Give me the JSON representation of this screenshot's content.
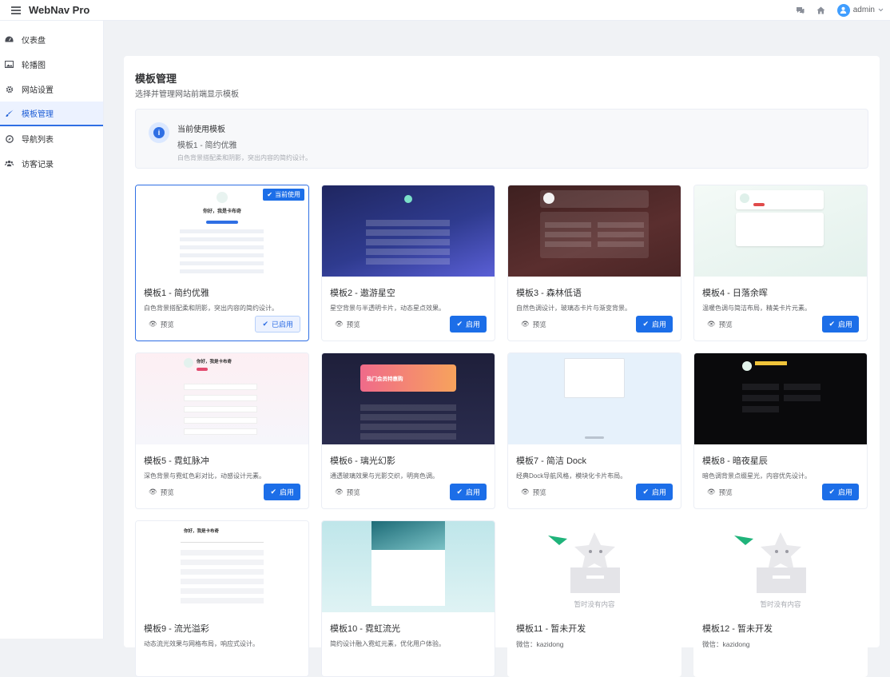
{
  "app": {
    "title": "WebNav Pro",
    "user": "admin"
  },
  "sidebar": {
    "items": [
      {
        "label": "仪表盘",
        "icon": "dashboard-icon"
      },
      {
        "label": "轮播图",
        "icon": "image-icon"
      },
      {
        "label": "网站设置",
        "icon": "gear-icon"
      },
      {
        "label": "模板管理",
        "icon": "brush-icon",
        "active": true
      },
      {
        "label": "导航列表",
        "icon": "compass-icon"
      },
      {
        "label": "访客记录",
        "icon": "users-icon"
      }
    ]
  },
  "page": {
    "title": "模板管理",
    "subtitle": "选择并管理网站前端显示模板"
  },
  "current": {
    "heading": "当前使用模板",
    "name": "模板1 - 简约优雅",
    "desc": "白色背景搭配柔和阴影，突出内容的简约设计。"
  },
  "labels": {
    "preview": "预览",
    "enable": "启用",
    "enabled": "已启用",
    "in_use": "当前使用"
  },
  "templates": [
    {
      "name": "模板1 - 简约优雅",
      "desc": "白色背景搭配柔和阴影，突出内容的简约设计。",
      "status": "active"
    },
    {
      "name": "模板2 - 遨游星空",
      "desc": "星空背景与半透明卡片，动态星点效果。",
      "status": "available"
    },
    {
      "name": "模板3 - 森林低语",
      "desc": "自然色调设计，玻璃态卡片与渐变背景。",
      "status": "available"
    },
    {
      "name": "模板4 - 日落余晖",
      "desc": "温暖色调与简洁布局，精美卡片元素。",
      "status": "available"
    },
    {
      "name": "模板5 - 霓虹脉冲",
      "desc": "深色背景与霓虹色彩对比，动感设计元素。",
      "status": "available"
    },
    {
      "name": "模板6 - 璃光幻影",
      "desc": "通透玻璃效果与光影交织，明亮色调。",
      "status": "available"
    },
    {
      "name": "模板7 - 简洁 Dock",
      "desc": "经典Dock导航风格，模块化卡片布局。",
      "status": "available"
    },
    {
      "name": "模板8 - 暗夜星辰",
      "desc": "暗色调背景点缀星光，内容优先设计。",
      "status": "available"
    },
    {
      "name": "模板9 - 流光溢彩",
      "desc": "动态流光效果与网格布局，响应式设计。",
      "status": "available"
    },
    {
      "name": "模板10 - 霓虹流光",
      "desc": "简约设计融入霓虹元素，优化用户体验。",
      "status": "available"
    },
    {
      "name": "模板11 - 暂未开发",
      "contact": "微信：kazidong",
      "empty": "暂时没有内容",
      "status": "placeholder"
    },
    {
      "name": "模板12 - 暂未开发",
      "contact": "微信：kazidong",
      "empty": "暂时没有内容",
      "status": "placeholder"
    }
  ],
  "thumb_text": {
    "t1_hello": "你好，我是卡布奇",
    "t5_hello": "你好，我是卡布奇",
    "t6_banner": "热门会员特惠购",
    "t9_hello": "你好，我是卡布奇"
  },
  "colors": {
    "accent": "#1c6ee8",
    "active_bg": "#ecf2ff"
  }
}
